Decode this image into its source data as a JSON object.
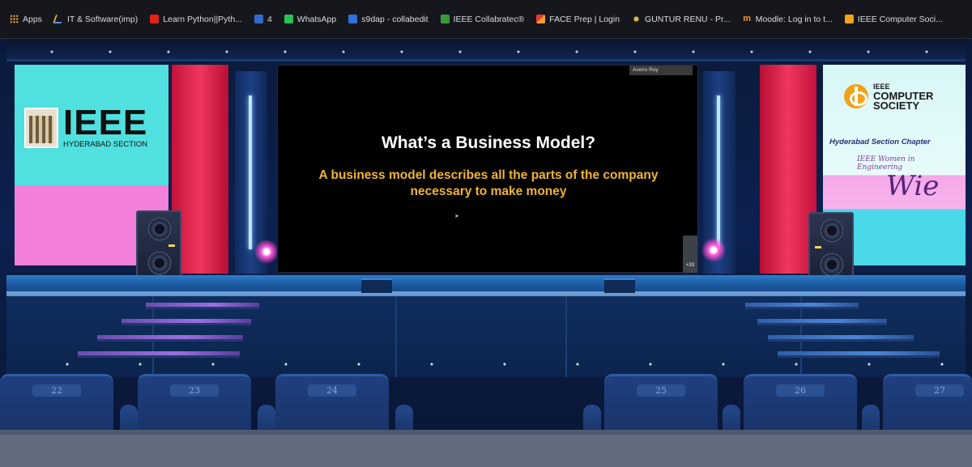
{
  "bookmarks": [
    {
      "label": "Apps",
      "icon": "apps-grid-icon"
    },
    {
      "label": "IT & Software(imp)",
      "icon": "it-software-icon"
    },
    {
      "label": "Learn Python||Pyth...",
      "icon": "youtube-icon"
    },
    {
      "label": "4",
      "icon": "numbered-page-icon"
    },
    {
      "label": "WhatsApp",
      "icon": "whatsapp-icon"
    },
    {
      "label": "s9dap - collabedit",
      "icon": "collabedit-icon"
    },
    {
      "label": "IEEE Collabratec®",
      "icon": "collabratec-icon"
    },
    {
      "label": "FACE Prep | Login",
      "icon": "faceprep-icon"
    },
    {
      "label": "GUNTUR RENU - Pr...",
      "icon": "sunburst-icon"
    },
    {
      "label": "Moodle: Log in to t...",
      "icon": "moodle-icon"
    },
    {
      "label": "IEEE Computer Soci...",
      "icon": "ieee-cs-icon"
    }
  ],
  "left_banner": {
    "logo_text": "IEEE",
    "subtitle": "HYDERABAD SECTION"
  },
  "right_banner": {
    "line1": "IEEE",
    "line2": "COMPUTER",
    "line3": "SOCIETY",
    "chapter": "Hyderabad Section Chapter",
    "wie_arc": "IEEE Women in Engineering",
    "wie_mark": "Wie"
  },
  "presentation": {
    "presenter_name": "Aveiro Roy",
    "title": "What’s a Business Model?",
    "body": "A business model describes all the parts of the company necessary to make money",
    "participant_count": "+33"
  },
  "seats": [
    "22",
    "23",
    "24",
    "25",
    "26",
    "27"
  ],
  "colors": {
    "bookmark_bar": "#15171c",
    "stage_blue": "#0d2150",
    "slide_title": "#ffffff",
    "slide_body": "#f0b431",
    "banner_cyan": "#4fe0df",
    "banner_pink": "#f27fd8",
    "panel_red": "#f0365e"
  }
}
